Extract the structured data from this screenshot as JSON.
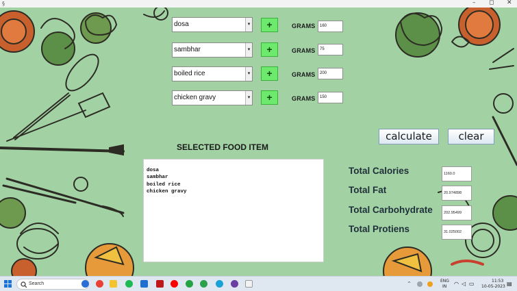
{
  "titlebar": {
    "app_icon": "java-icon",
    "minimize": "–",
    "maximize": "◻",
    "close": "✕"
  },
  "foods": [
    {
      "name": "dosa",
      "grams_label": "GRAMS",
      "grams": "160"
    },
    {
      "name": "sambhar",
      "grams_label": "GRAMS",
      "grams": "75"
    },
    {
      "name": "boiled rice",
      "grams_label": "GRAMS",
      "grams": "200"
    },
    {
      "name": "chicken gravy",
      "grams_label": "GRAMS",
      "grams": "150"
    }
  ],
  "add_button_label": "+",
  "dropdown_arrow": "▾",
  "buttons": {
    "calculate": "calculate",
    "clear": "clear"
  },
  "selected": {
    "title": "SELECTED FOOD ITEM",
    "items": [
      "dosa",
      "sambhar",
      "boiled rice",
      "chicken gravy"
    ]
  },
  "totals": [
    {
      "label": "Total Calories",
      "value": "1160.0"
    },
    {
      "label": "Total Fat",
      "value": "20.974898"
    },
    {
      "label": "Total Carbohydrate",
      "value": "202.95499"
    },
    {
      "label": "Total Protiens",
      "value": "31.025002"
    }
  ],
  "taskbar": {
    "search_placeholder": "Search",
    "lang_top": "ENG",
    "lang_bottom": "IN",
    "time": "11:53",
    "date": "10-05-2023"
  },
  "colors": {
    "background": "#a2d2a4",
    "add_button": "#6dea6d",
    "taskbar": "#dfe7f0"
  }
}
